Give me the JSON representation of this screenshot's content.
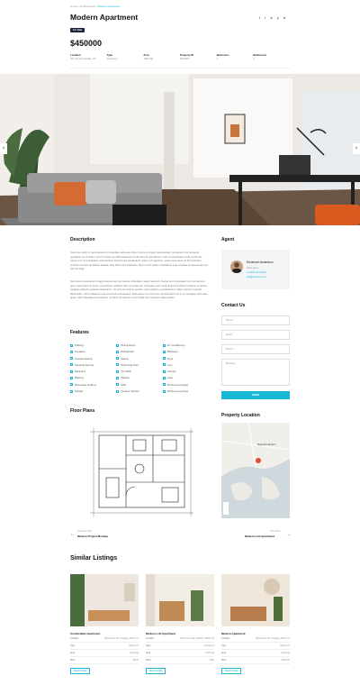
{
  "breadcrumb": [
    "Home",
    "Architectures",
    "Modern Apartment"
  ],
  "title": "Modern Apartment",
  "badge": "For Sale",
  "price": "$450000",
  "social_icons": [
    "facebook-icon",
    "twitter-icon",
    "linkedin-icon",
    "pinterest-icon",
    "telegram-icon"
  ],
  "meta": [
    {
      "label": "Location",
      "value": "321 City Ave Seattle, US"
    },
    {
      "label": "Type",
      "value": "Apartment"
    },
    {
      "label": "Area",
      "value": "1200 sqft"
    },
    {
      "label": "Property ID",
      "value": "ESTW03"
    },
    {
      "label": "Bedrooms",
      "value": "2"
    },
    {
      "label": "Bathrooms",
      "value": "2"
    }
  ],
  "description": {
    "heading": "Description",
    "p1": "Aute irure dolor in reprehenderit in voluptate velit esse cillum dolore eu fugiat nulla pariatur. Excepteur sint occaecat cupidatat non proident, sunt in culpa qui officia deserunt mollit anim id est laborum. Sed ut perspiciatis unde omnis iste natus error sit voluptatem accusantium doloremque laudantium, totam rem aperiam, eaque ipsa quae ab illo inventore veritatis et quasi architecto beatae vitae dicta sunt explicabo. Nemo enim ipsam voluptatem quia voluptas sit aspernatur aut odit aut fugit.",
    "p2": "Sed quia consequuntur magni dolores eos qui ratione voluptatem sequi nesciunt. Neque porro quisquam est, qui dolorem ipsum quia dolor sit amet, consectetur, adipisci velit, sed quia non numquam eius modi tempora incidunt ut labore et dolore magnam aliquam quaerat voluptatem. Ut enim ad minima veniam, quis nostrum exercitationem ullam corporis suscipit laboriosam, nisi ut aliquid ex ea commodi consequatur. Quis autem vel eum iure reprehenderit qui in ea voluptate velit esse quam nihil molestiae consequatur, vel illum qui dolorem eum fugiat quo voluptas nulla pariatur."
  },
  "agent": {
    "heading": "Agent",
    "name": "Emanuel Anderson",
    "role": "Sales agent",
    "phone": "+1 (815) 514-8432",
    "email": "info@estwork.com"
  },
  "contact": {
    "heading": "Contact Us",
    "name_placeholder": "Name*",
    "email_placeholder": "Email*",
    "phone_placeholder": "Phone*",
    "message_placeholder": "Message",
    "send_label": "SEND"
  },
  "features": {
    "heading": "Features",
    "items": [
      "Parking",
      "Dining Room",
      "Air Conditioning",
      "Fireplace",
      "Refrigerator",
      "Barbeque",
      "Central Heating",
      "Sauna",
      "Dryer",
      "Cleaning Service",
      "Swimming Pool",
      "Gym",
      "Backyard",
      "TV Cable",
      "Laundry",
      "Balcony",
      "Washer",
      "Lawn",
      "Microwave Outdoor",
      "WiFi",
      "Window Coverings",
      "Shower",
      "Outdoor Shower",
      "Window Coverings"
    ]
  },
  "floor_plans": {
    "heading": "Floor Plans"
  },
  "property_location": {
    "heading": "Property Location",
    "map_place": "Bogotá Nautico"
  },
  "post_nav": {
    "prev_label": "Previous Post",
    "prev_title": "Modern Project Mockup",
    "next_label": "Next Post",
    "next_title": "Modern Loft Apartment"
  },
  "similar": {
    "heading": "Similar Listings",
    "cards": [
      {
        "title": "Comfortable Apartment",
        "rows": [
          [
            "Location",
            "1925 Green Rd, Chicago, 60601 US"
          ],
          [
            "Type",
            "Apartment"
          ],
          [
            "Area",
            "1000 sqft"
          ],
          [
            "Price",
            "$1100"
          ]
        ],
        "button": "READ MORE"
      },
      {
        "title": "Modern Loft Apartment",
        "rows": [
          [
            "Location",
            "1925 Green Rd, Chicago, 60601 US"
          ],
          [
            "Type",
            "Apartment"
          ],
          [
            "Area",
            "1000 sqft"
          ],
          [
            "Price",
            "$950"
          ]
        ],
        "button": "READ MORE"
      },
      {
        "title": "Modern Apartment",
        "rows": [
          [
            "Location",
            "1925 Green Rd, Chicago, 60601 US"
          ],
          [
            "Type",
            "Apartment"
          ],
          [
            "Area",
            "1200 sqft"
          ],
          [
            "Price",
            "$450000"
          ]
        ],
        "button": "READ MORE"
      }
    ]
  }
}
